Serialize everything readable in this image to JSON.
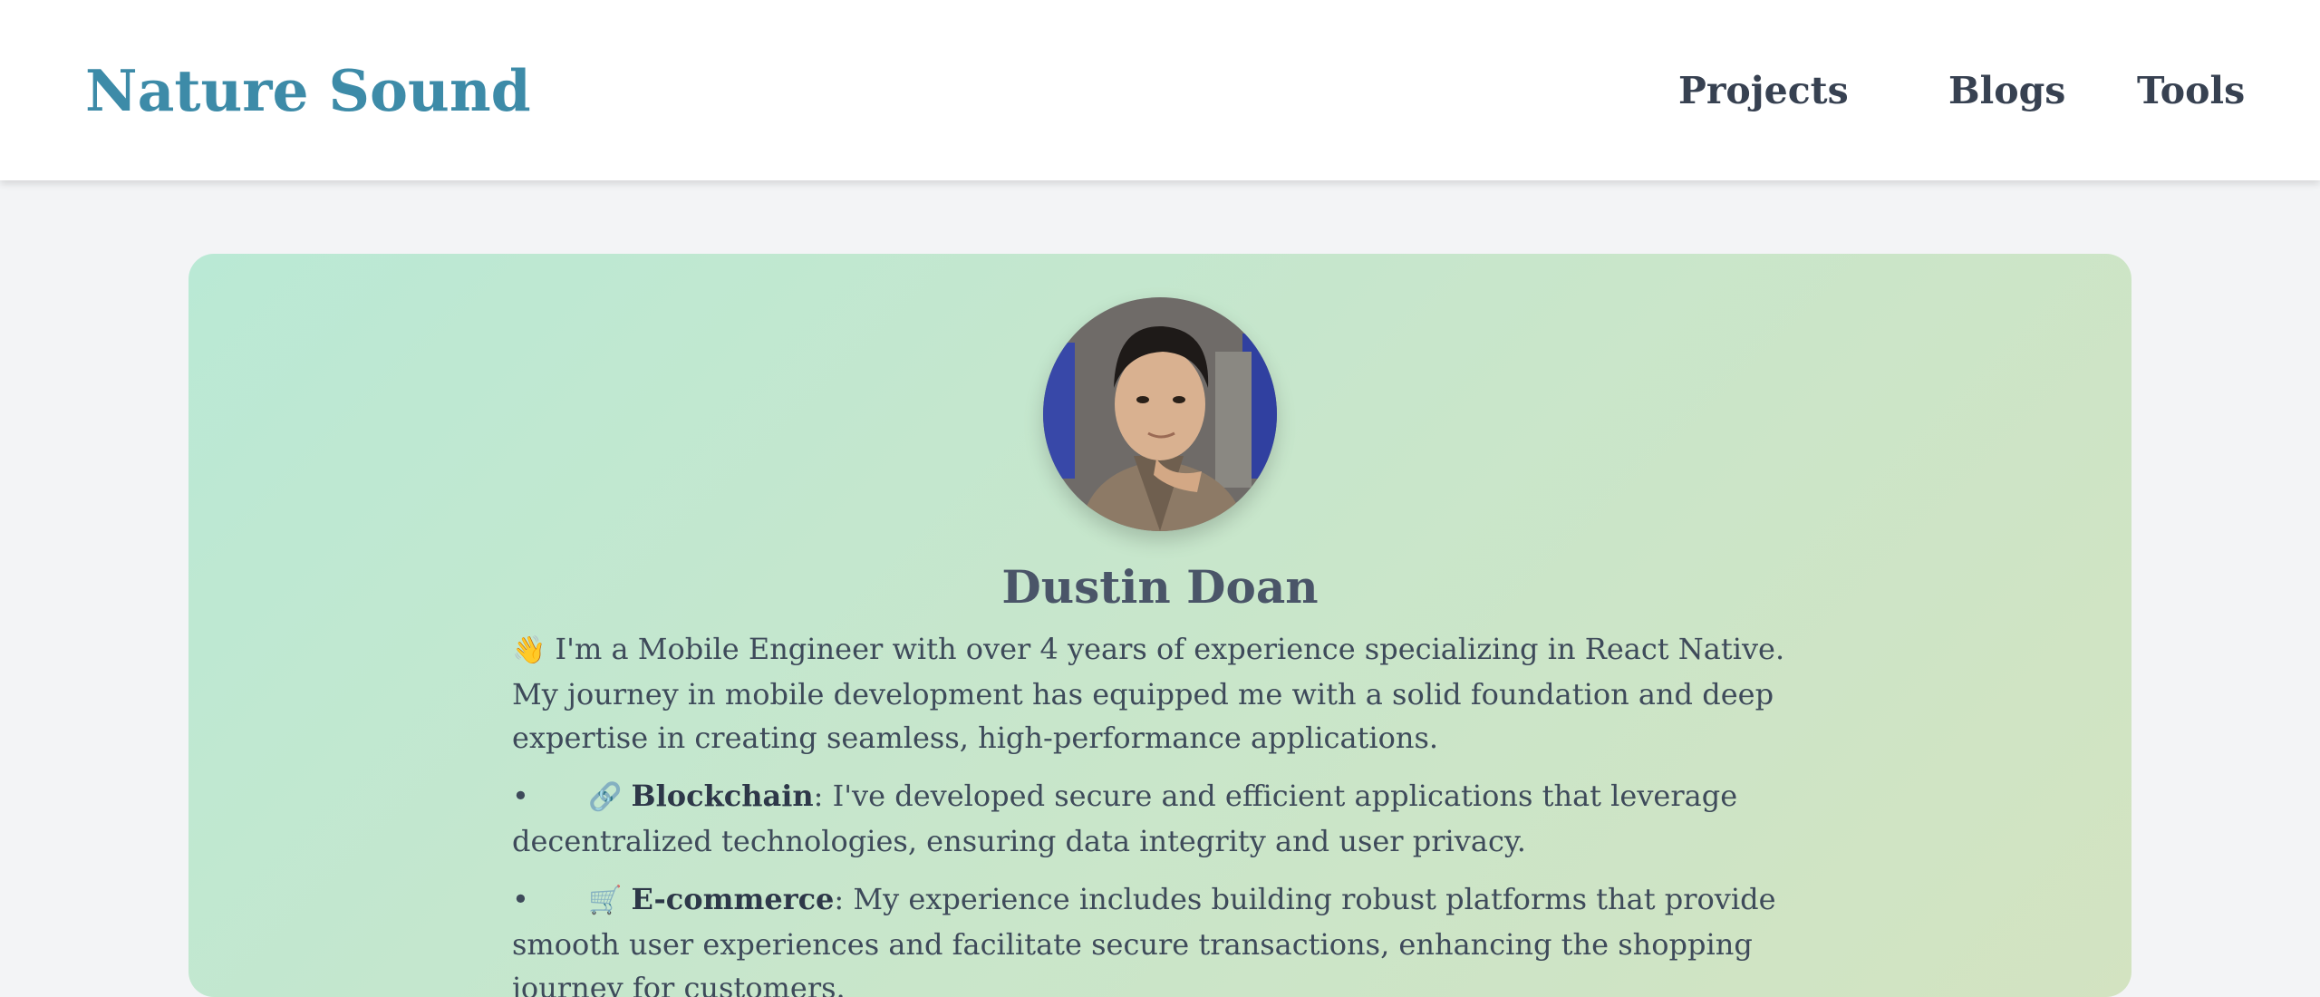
{
  "header": {
    "logo": "Nature Sound",
    "nav": [
      {
        "label": "Projects"
      },
      {
        "label": "Blogs"
      },
      {
        "label": "Tools"
      }
    ]
  },
  "profile": {
    "name": "Dustin Doan",
    "avatar_icon": "profile-photo",
    "intro_emoji": "👋",
    "intro": "I'm a Mobile Engineer with over 4 years of experience specializing in React Native. My journey in mobile development has equipped me with a solid foundation and deep expertise in creating seamless, high-performance applications.",
    "skills": [
      {
        "emoji": "🔗",
        "title": "Blockchain",
        "text": ": I've developed secure and efficient applications that leverage decentralized technologies, ensuring data integrity and user privacy."
      },
      {
        "emoji": "🛒",
        "title": "E-commerce",
        "text": ": My experience includes building robust platforms that provide smooth user experiences and facilitate secure transactions, enhancing the shopping journey for customers."
      }
    ]
  },
  "colors": {
    "logo": "#3d8ba8",
    "nav_text": "#374151",
    "page_bg": "#f3f4f6",
    "card_gradient_start": "#bae9d5",
    "card_gradient_end": "#d3e3c1",
    "name_text": "#4a5568"
  }
}
